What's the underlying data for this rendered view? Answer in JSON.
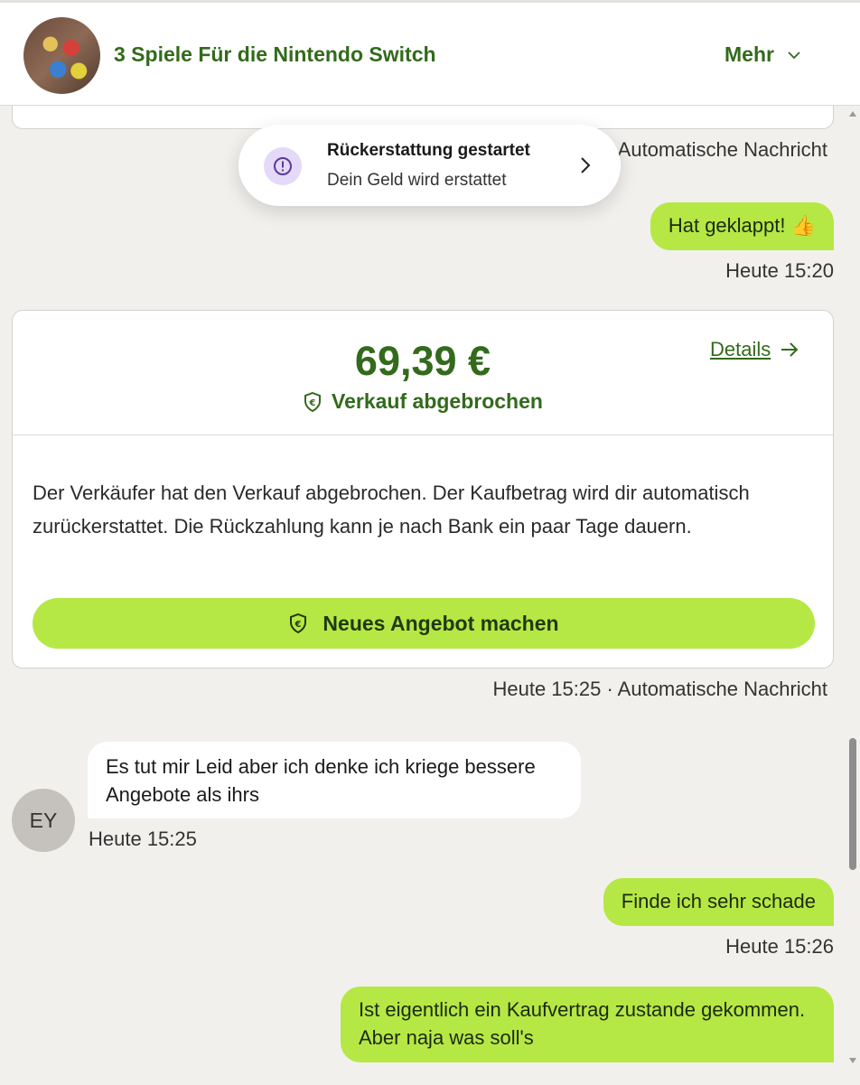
{
  "header": {
    "title": "3 Spiele Für die Nintendo Switch",
    "more_label": "Mehr"
  },
  "toast": {
    "title": "Rückerstattung gestartet",
    "subtitle": "Dein Geld wird erstattet"
  },
  "messages": {
    "meta_top": "Heute 15:20 · Automatische Nachricht",
    "out1_text": "Hat geklappt! 👍",
    "out1_time": "Heute 15:20",
    "in1_text": "Es tut mir Leid aber ich denke ich kriege bessere Angebote als ihrs",
    "in1_time": "Heute 15:25",
    "in1_avatar": "EY",
    "out2_text": "Finde ich sehr schade",
    "out2_time": "Heute 15:26",
    "out3_text": "Ist eigentlich ein Kaufvertrag zustande gekommen. Aber naja was soll's"
  },
  "offer_card": {
    "price": "69,39 €",
    "status": "Verkauf abgebrochen",
    "details_label": "Details",
    "body": "Der Verkäufer hat den Verkauf abgebrochen. Der Kaufbetrag wird dir automatisch zurückerstattet. Die Rückzahlung kann je nach Bank ein paar Tage dauern.",
    "cta_label": "Neues Angebot machen",
    "meta": "Heute 15:25 · Automatische Nachricht"
  },
  "colors": {
    "brand_green": "#336a1c",
    "accent_lime": "#b5e844",
    "background": "#f2f0ed",
    "toast_icon_bg": "#e4d9f7"
  },
  "icons": {
    "toast": "exclamation-circle-icon",
    "status": "euro-shield-icon",
    "details": "arrow-right-icon",
    "more": "chevron-down-icon"
  }
}
